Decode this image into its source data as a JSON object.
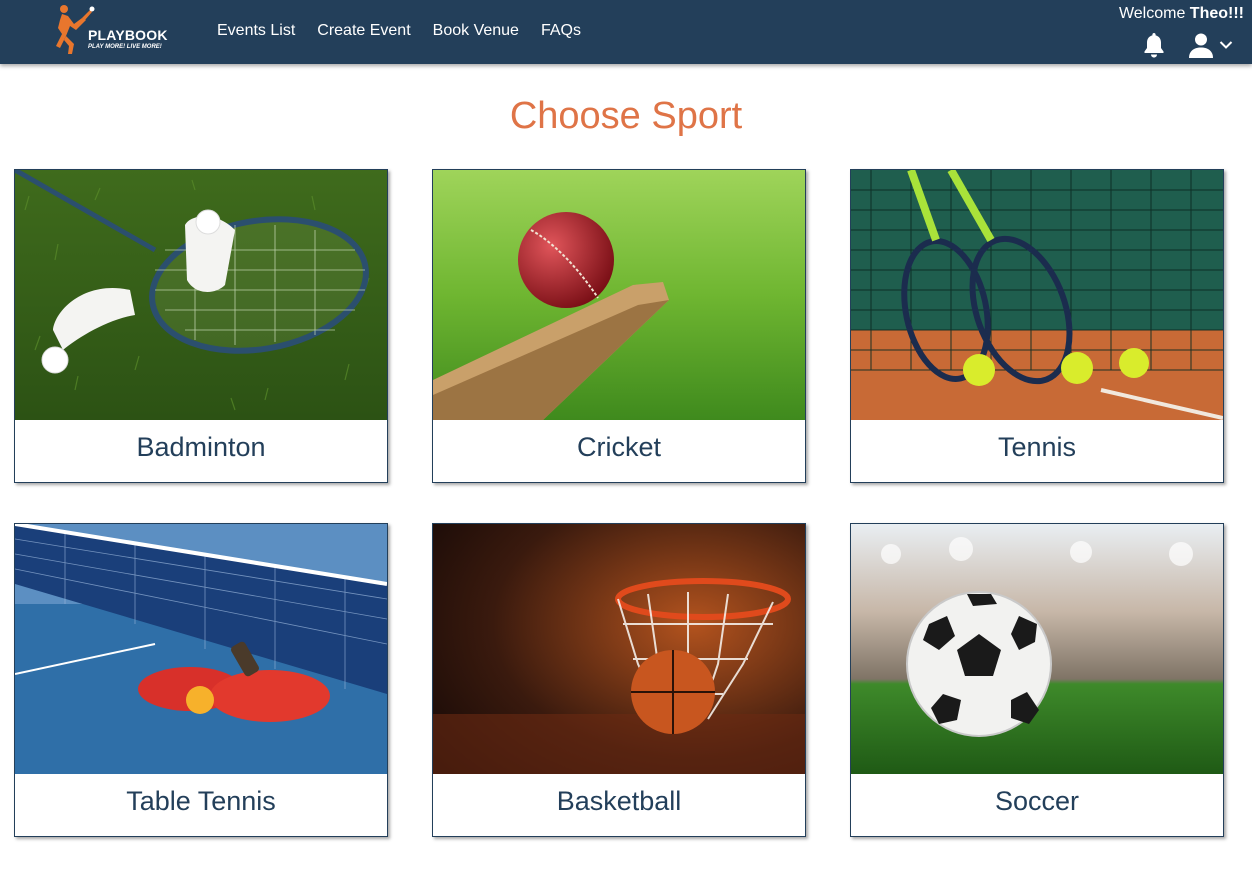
{
  "brand": {
    "name": "PLAYBOOK",
    "tagline": "PLAY MORE! LIVE MORE!"
  },
  "nav": {
    "links": [
      "Events List",
      "Create Event",
      "Book Venue",
      "FAQs"
    ]
  },
  "header": {
    "welcome_prefix": "Welcome",
    "user_name": "Theo!!!",
    "icons": [
      "bell-icon",
      "user-icon",
      "chevron-down-icon"
    ]
  },
  "main": {
    "title": "Choose Sport",
    "sports": [
      {
        "label": "Badminton"
      },
      {
        "label": "Cricket"
      },
      {
        "label": "Tennis"
      },
      {
        "label": "Table Tennis"
      },
      {
        "label": "Basketball"
      },
      {
        "label": "Soccer"
      }
    ]
  },
  "colors": {
    "navbar": "#233f5a",
    "accent": "#df7447",
    "card_text": "#233f5a"
  }
}
